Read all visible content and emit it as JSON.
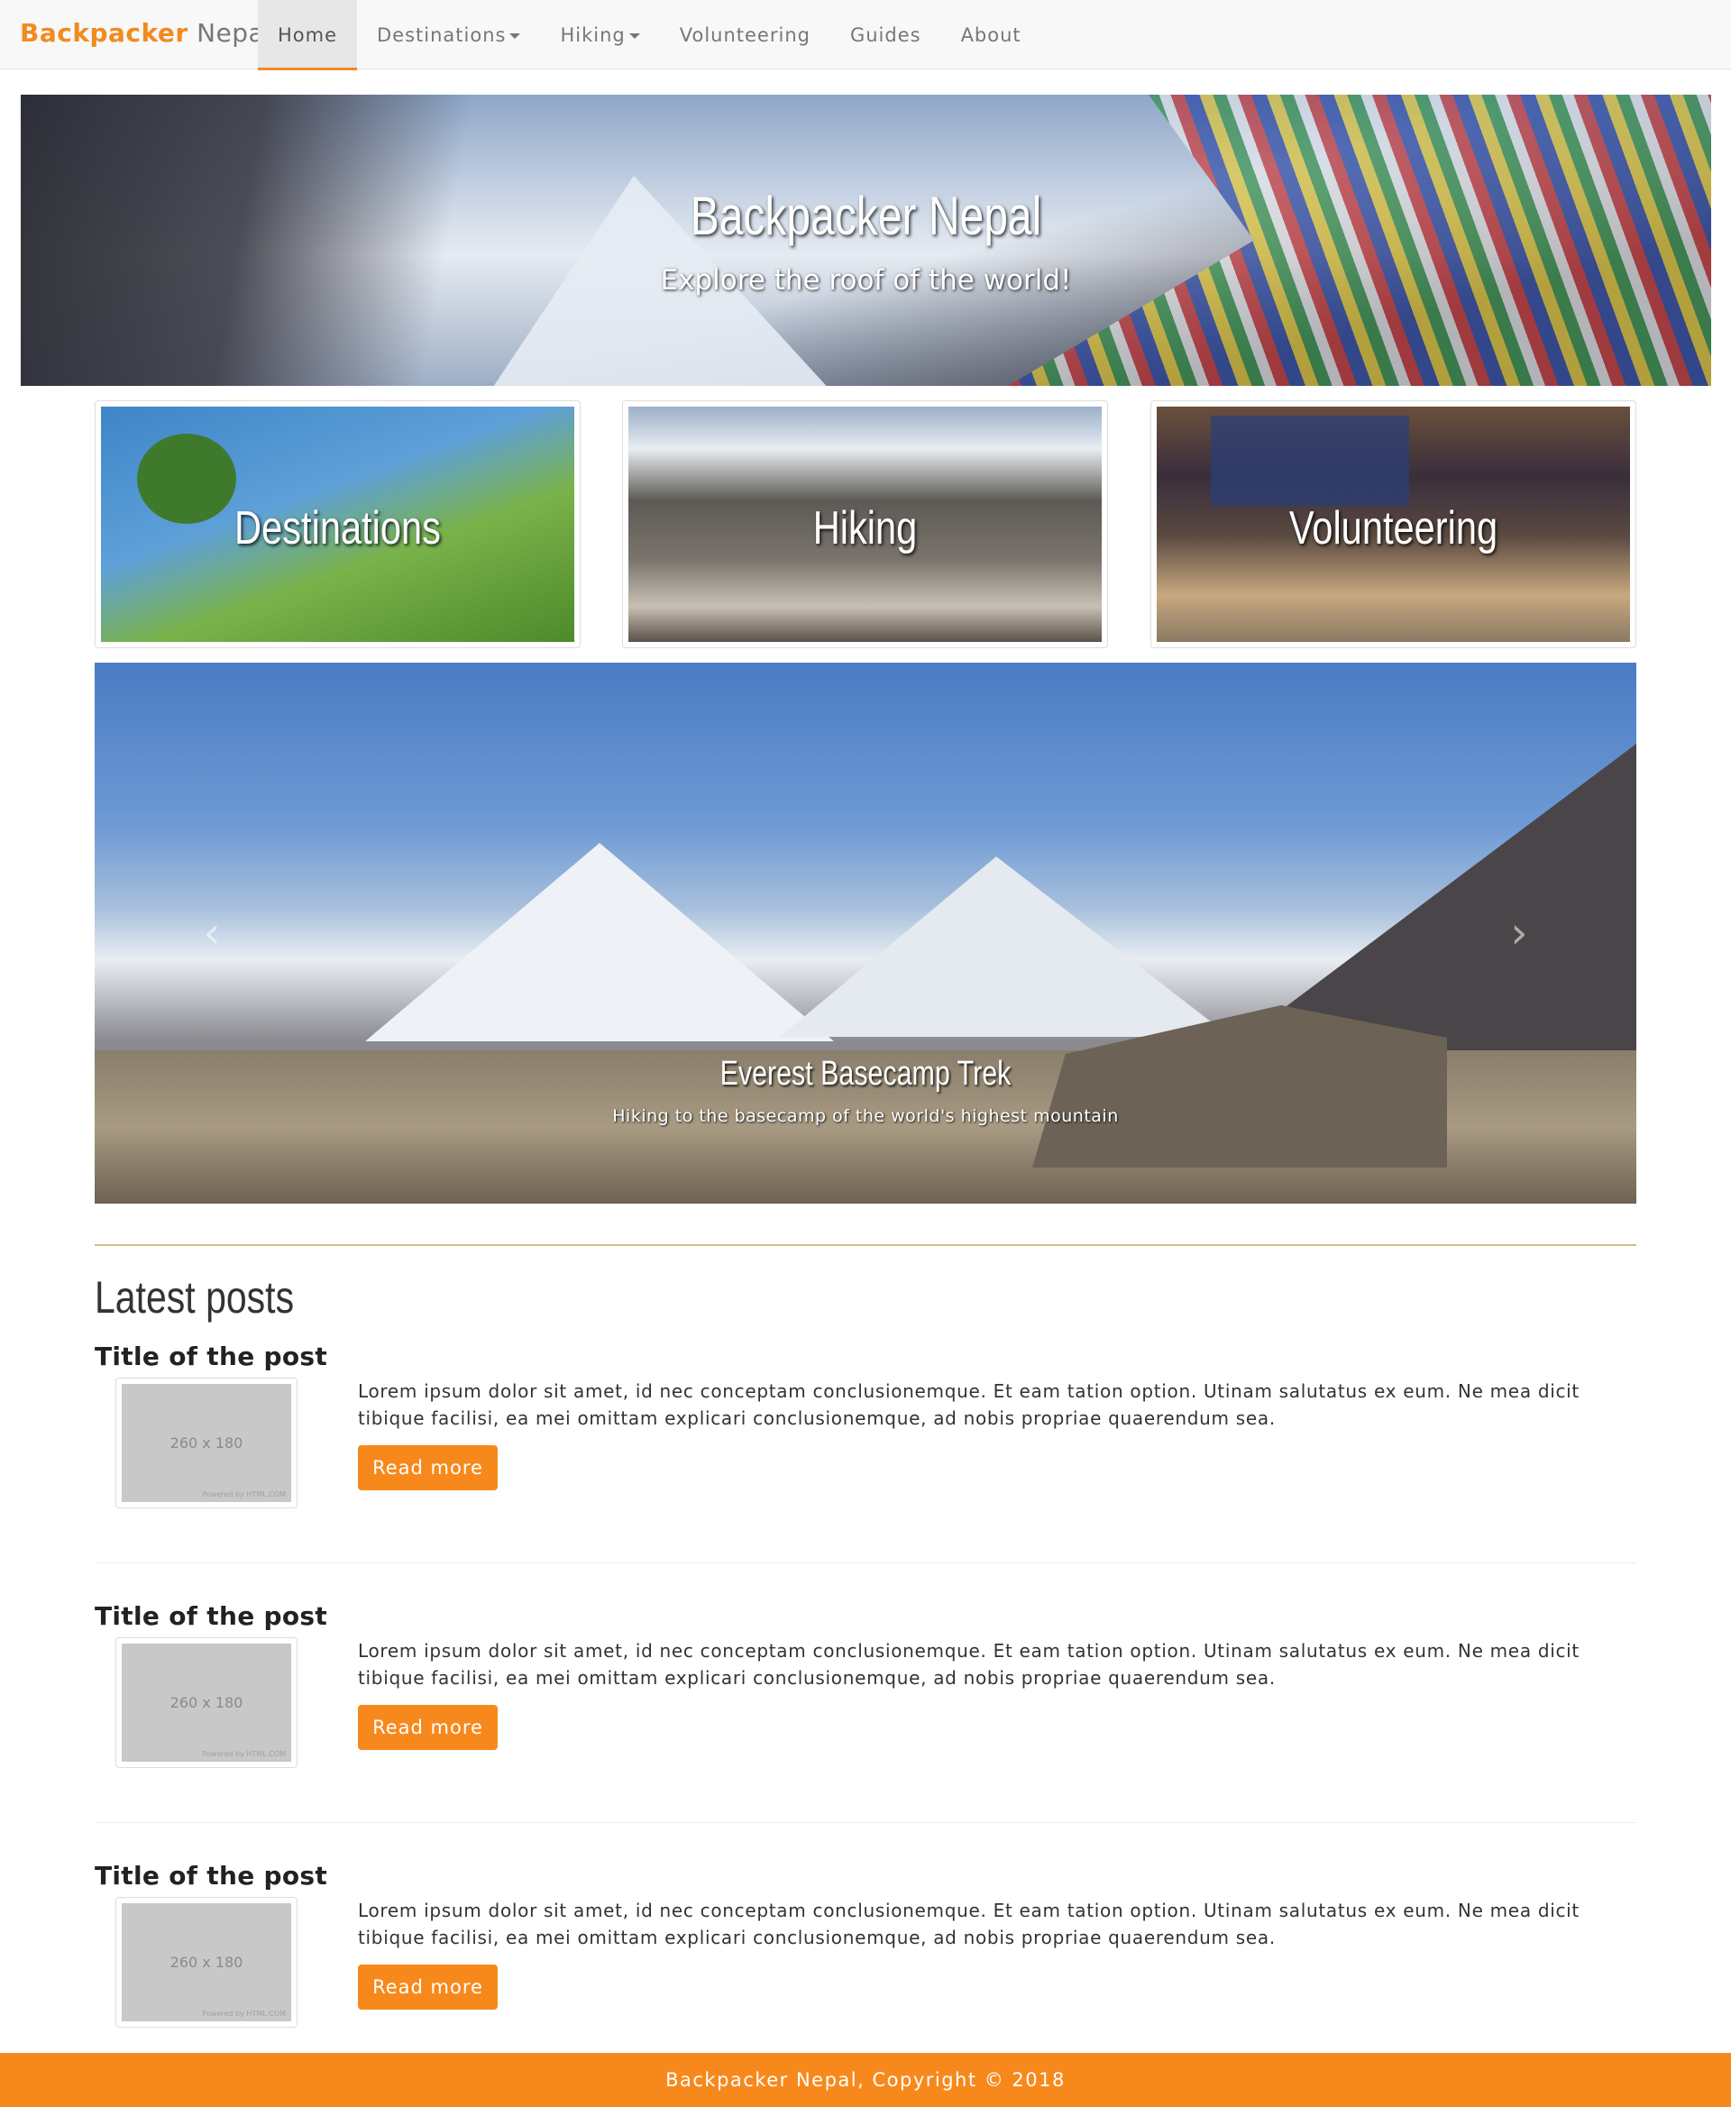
{
  "brand": {
    "accent": "Backpacker",
    "rest": "Nepal"
  },
  "nav": {
    "items": [
      {
        "label": "Home",
        "active": true,
        "dropdown": false
      },
      {
        "label": "Destinations",
        "active": false,
        "dropdown": true
      },
      {
        "label": "Hiking",
        "active": false,
        "dropdown": true
      },
      {
        "label": "Volunteering",
        "active": false,
        "dropdown": false
      },
      {
        "label": "Guides",
        "active": false,
        "dropdown": false
      },
      {
        "label": "About",
        "active": false,
        "dropdown": false
      }
    ]
  },
  "hero": {
    "title": "Backpacker Nepal",
    "subtitle": "Explore the roof of the world!"
  },
  "thumbnails": [
    {
      "label": "Destinations"
    },
    {
      "label": "Hiking"
    },
    {
      "label": "Volunteering"
    }
  ],
  "carousel": {
    "caption_title": "Everest Basecamp Trek",
    "caption_sub": "Hiking to the basecamp of the world's highest mountain",
    "prev_icon": "chevron-left-icon",
    "next_icon": "chevron-right-icon"
  },
  "latest": {
    "title": "Latest posts",
    "posts": [
      {
        "title": "Title of the post",
        "image_text": "260 x 180",
        "image_credit": "Powered by HTML.COM",
        "text": "Lorem ipsum dolor sit amet, id nec conceptam conclusionemque. Et eam tation option. Utinam salutatus ex eum. Ne mea dicit tibique facilisi, ea mei omittam explicari conclusionemque, ad nobis propriae quaerendum sea.",
        "button": "Read more"
      },
      {
        "title": "Title of the post",
        "image_text": "260 x 180",
        "image_credit": "Powered by HTML.COM",
        "text": "Lorem ipsum dolor sit amet, id nec conceptam conclusionemque. Et eam tation option. Utinam salutatus ex eum. Ne mea dicit tibique facilisi, ea mei omittam explicari conclusionemque, ad nobis propriae quaerendum sea.",
        "button": "Read more"
      },
      {
        "title": "Title of the post",
        "image_text": "260 x 180",
        "image_credit": "Powered by HTML.COM",
        "text": "Lorem ipsum dolor sit amet, id nec conceptam conclusionemque. Et eam tation option. Utinam salutatus ex eum. Ne mea dicit tibique facilisi, ea mei omittam explicari conclusionemque, ad nobis propriae quaerendum sea.",
        "button": "Read more"
      }
    ]
  },
  "footer": {
    "text": "Backpacker Nepal, Copyright © 2018"
  },
  "colors": {
    "accent": "#f7891c",
    "navbar_bg": "#f8f8f8",
    "divider": "#d9b98a"
  }
}
